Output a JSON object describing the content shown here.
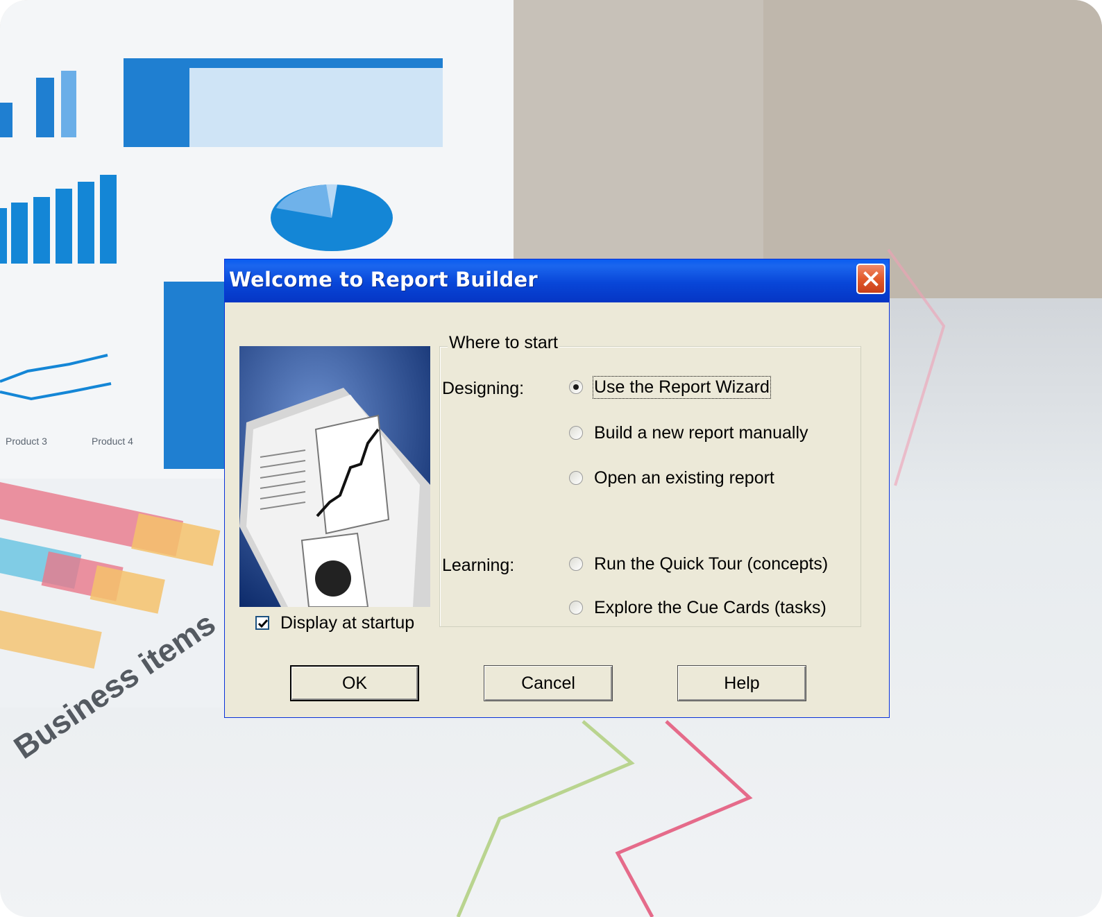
{
  "background": {
    "caption": "Business items",
    "chart_labels": [
      "Product 3",
      "Product 4"
    ]
  },
  "dialog": {
    "title": "Welcome to Report Builder",
    "group_caption": "Where to start",
    "designing_label": "Designing:",
    "learning_label": "Learning:",
    "options": [
      {
        "label": "Use the Report Wizard",
        "selected": true
      },
      {
        "label": "Build a new report manually",
        "selected": false
      },
      {
        "label": "Open an existing report",
        "selected": false
      },
      {
        "label": "Run the Quick Tour (concepts)",
        "selected": false
      },
      {
        "label": "Explore the Cue Cards (tasks)",
        "selected": false
      }
    ],
    "display_at_startup": {
      "label": "Display at startup",
      "checked": true
    },
    "buttons": {
      "ok": "OK",
      "cancel": "Cancel",
      "help": "Help"
    }
  },
  "colors": {
    "titlebar": "#0846d8",
    "dialog_face": "#ece9d8",
    "close_button": "#e25a2a"
  }
}
